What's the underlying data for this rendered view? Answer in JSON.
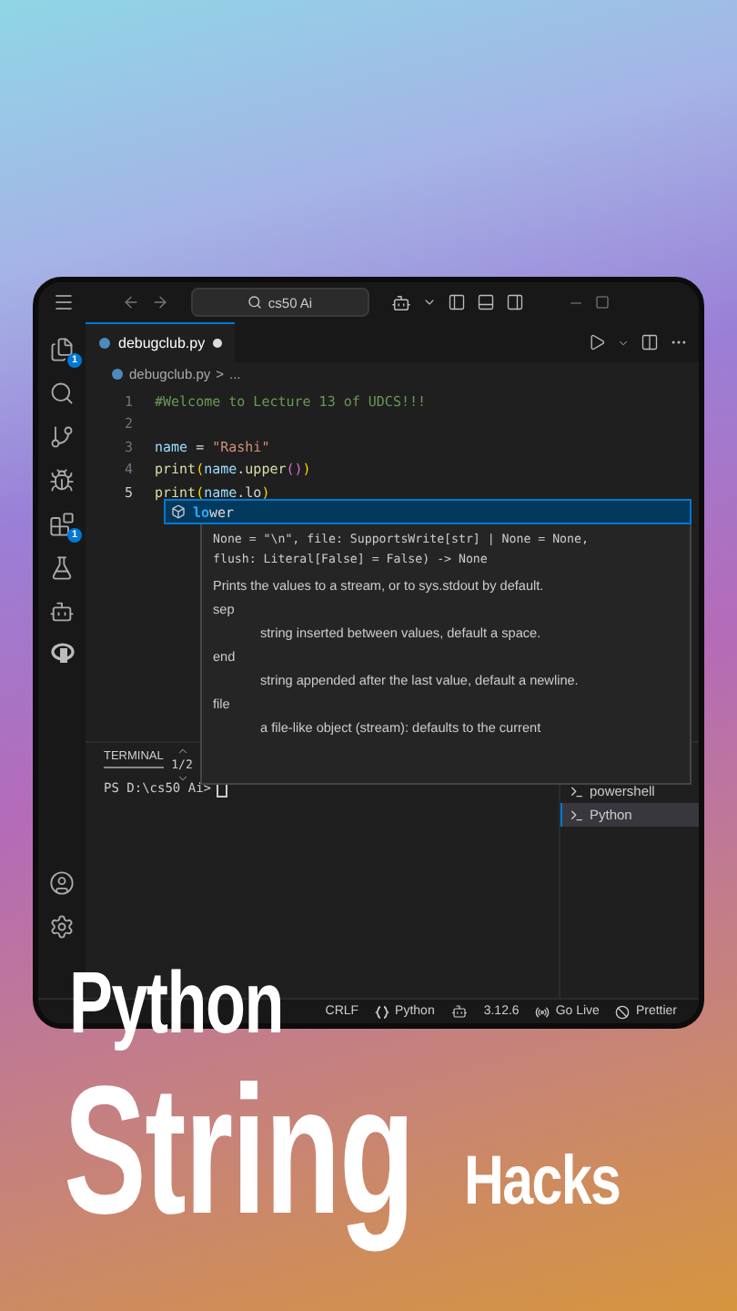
{
  "title_bar": {
    "search": "cs50 Ai"
  },
  "activity_bar": {
    "items": [
      {
        "kind": "files",
        "badge": "1"
      },
      {
        "kind": "search"
      },
      {
        "kind": "source-control"
      },
      {
        "kind": "run"
      },
      {
        "kind": "extensions",
        "badge": "1"
      },
      {
        "kind": "flask"
      },
      {
        "kind": "robot"
      },
      {
        "kind": "r"
      }
    ],
    "bottom": [
      {
        "kind": "account"
      },
      {
        "kind": "settings"
      }
    ]
  },
  "tabs": [
    {
      "label": "debugclub.py",
      "selected": true,
      "modified": true
    }
  ],
  "breadcrumb": [
    "debugclub.py",
    ">",
    "..."
  ],
  "code": [
    {
      "number": "1",
      "current": false,
      "tokens": [
        {
          "kind": "comment",
          "text": "#Welcome to Lecture 13 of UDCS!!!"
        }
      ]
    },
    {
      "number": "2",
      "current": false
    },
    {
      "number": "3",
      "current": false,
      "tokens": [
        {
          "kind": "var",
          "text": "name"
        },
        {
          "kind": "plain",
          "text": " = "
        },
        {
          "kind": "string",
          "text": "\"Rashi\""
        }
      ]
    },
    {
      "number": "4",
      "current": false,
      "tokens": [
        {
          "kind": "func",
          "text": "print"
        },
        {
          "kind": "paren",
          "text": "("
        },
        {
          "kind": "var",
          "text": "name"
        },
        {
          "kind": "plain",
          "text": "."
        },
        {
          "kind": "func",
          "text": "upper"
        },
        {
          "kind": "paren2",
          "text": "()"
        },
        {
          "kind": "paren",
          "text": ")"
        }
      ]
    },
    {
      "number": "5",
      "current": true,
      "tokens": [
        {
          "kind": "func",
          "text": "print"
        },
        {
          "kind": "paren",
          "text": "("
        },
        {
          "kind": "var",
          "text": "name"
        },
        {
          "kind": "plain",
          "text": ".lo"
        },
        {
          "kind": "paren",
          "text": ")"
        }
      ]
    }
  ],
  "suggest": {
    "items": [
      {
        "match": "lo",
        "rest": "wer",
        "selected": true
      }
    ],
    "signature": [
      "None = \"\\n\", file: SupportsWrite[str] | None = None,",
      "flush: Literal[False] = False) -> None"
    ],
    "description": "Prints the values to a stream, or to sys.stdout by default.",
    "params": [
      {
        "name": "sep",
        "text": "string inserted between values, default a space."
      },
      {
        "name": "end",
        "text": "string appended after the last value, default a newline."
      },
      {
        "name": "file",
        "text": "a file-like object (stream): defaults to the current"
      }
    ],
    "counter": "1/2"
  },
  "panel": {
    "tab": "TERMINAL",
    "prompt": "PS D:\\cs50 Ai>",
    "terminals": [
      {
        "label": "powershell",
        "selected": false
      },
      {
        "label": "Python",
        "selected": true
      }
    ]
  },
  "status_bar": [
    {
      "kind": "text",
      "text": "CRLF"
    },
    {
      "kind": "braces",
      "text": "Python"
    },
    {
      "kind": "copilot"
    },
    {
      "kind": "text",
      "text": "3.12.6"
    },
    {
      "kind": "live",
      "text": "Go Live"
    },
    {
      "kind": "prettier",
      "text": "Prettier"
    }
  ],
  "headline": {
    "line_1": "Python",
    "line_2": "String",
    "line_3": "Hacks"
  }
}
